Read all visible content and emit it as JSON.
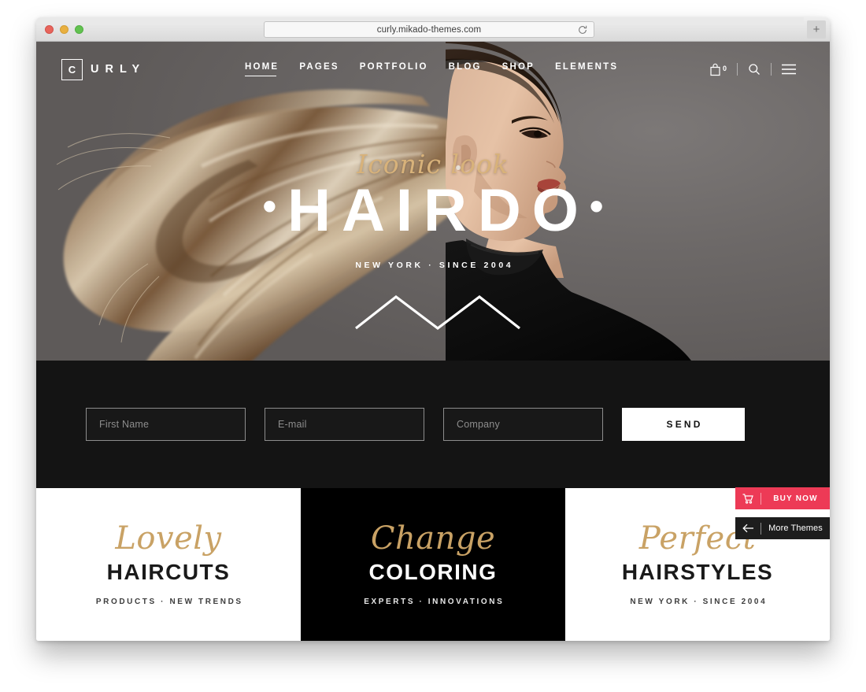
{
  "browser": {
    "url": "curly.mikado-themes.com",
    "reload_icon": "reload-icon",
    "newtab_label": "+",
    "traffic_lights": [
      "close",
      "minimize",
      "zoom"
    ]
  },
  "site": {
    "logo": {
      "initial": "C",
      "rest": "URLY",
      "full": "CURLY"
    },
    "nav": [
      {
        "label": "HOME",
        "active": true
      },
      {
        "label": "PAGES",
        "active": false
      },
      {
        "label": "PORTFOLIO",
        "active": false
      },
      {
        "label": "BLOG",
        "active": false
      },
      {
        "label": "SHOP",
        "active": false
      },
      {
        "label": "ELEMENTS",
        "active": false
      }
    ],
    "header_icons": {
      "cart_icon": "shopping-bag-icon",
      "cart_count": "0",
      "search_icon": "search-icon",
      "menu_icon": "hamburger-menu-icon"
    }
  },
  "hero": {
    "script_line": "Iconic look",
    "title": "HAIRDO",
    "title_dot": "•",
    "subtitle": "NEW YORK · SINCE 2004"
  },
  "signup_form": {
    "fields": [
      {
        "name": "first-name",
        "placeholder": "First Name",
        "value": ""
      },
      {
        "name": "email",
        "placeholder": "E-mail",
        "value": ""
      },
      {
        "name": "company",
        "placeholder": "Company",
        "value": ""
      }
    ],
    "submit_label": "SEND"
  },
  "panels": [
    {
      "script": "Lovely",
      "title": "HAIRCUTS",
      "meta": "PRODUCTS · NEW TRENDS",
      "theme": "light"
    },
    {
      "script": "Change",
      "title": "COLORING",
      "meta": "EXPERTS · INNOVATIONS",
      "theme": "dark"
    },
    {
      "script": "Perfect",
      "title": "HAIRSTYLES",
      "meta": "NEW YORK · SINCE 2004",
      "theme": "light"
    }
  ],
  "floating_promos": [
    {
      "label": "BUY NOW",
      "icon": "cart-icon",
      "color": "#ed3a56"
    },
    {
      "label": "More Themes",
      "icon": "arrow-left-icon",
      "color": "#1d1d1d"
    }
  ],
  "colors": {
    "hero_bg": "#6b6867",
    "dark_strip": "#141414",
    "gold_script": "#c9a265",
    "hero_gold": "#d8b27a",
    "promo_red": "#ed3a56",
    "panel_black": "#000000"
  }
}
